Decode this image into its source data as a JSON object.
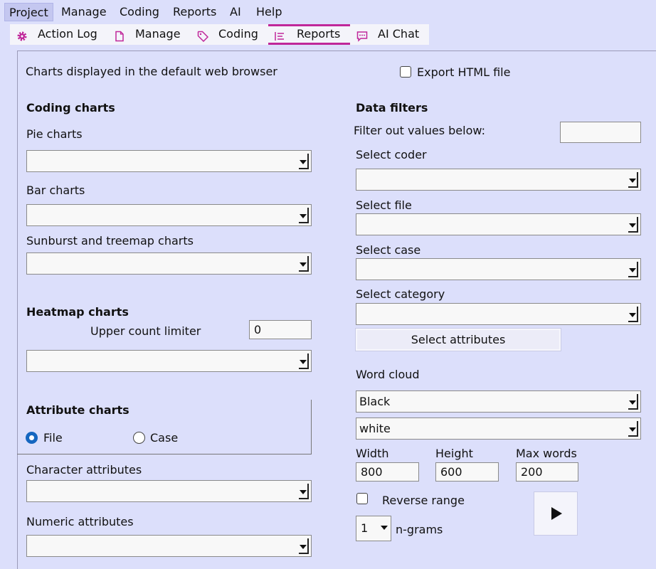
{
  "menu": {
    "items": [
      {
        "label": "Project"
      },
      {
        "label": "Manage"
      },
      {
        "label": "Coding"
      },
      {
        "label": "Reports"
      },
      {
        "label": "AI"
      },
      {
        "label": "Help"
      }
    ],
    "active": "Project"
  },
  "tabs": {
    "items": [
      {
        "label": "Action Log",
        "icon": "gear-icon"
      },
      {
        "label": "Manage",
        "icon": "document-icon"
      },
      {
        "label": "Coding",
        "icon": "tag-icon"
      },
      {
        "label": "Reports",
        "icon": "list-icon"
      },
      {
        "label": "AI Chat",
        "icon": "chat-icon"
      }
    ],
    "active": "Reports",
    "accent_color": "#c0279a"
  },
  "header": {
    "description": "Charts displayed in the default web browser",
    "export_label": "Export HTML file",
    "export_checked": false
  },
  "coding_charts": {
    "title": "Coding charts",
    "pie_label": "Pie charts",
    "pie_value": "",
    "bar_label": "Bar charts",
    "bar_value": "",
    "sunburst_label": "Sunburst and treemap charts",
    "sunburst_value": ""
  },
  "heatmap": {
    "title": "Heatmap charts",
    "limiter_label": "Upper count limiter",
    "limiter_value": "0",
    "select_value": ""
  },
  "attribute_charts": {
    "title": "Attribute charts",
    "radio_file": "File",
    "radio_case": "Case",
    "selected": "File",
    "character_label": "Character attributes",
    "character_value": "",
    "numeric_label": "Numeric attributes",
    "numeric_value": ""
  },
  "data_filters": {
    "title": "Data filters",
    "filter_label": "Filter out values below:",
    "filter_value": "",
    "coder_label": "Select coder",
    "coder_value": "",
    "file_label": "Select file",
    "file_value": "",
    "case_label": "Select case",
    "case_value": "",
    "category_label": "Select category",
    "category_value": "",
    "attributes_button": "Select attributes"
  },
  "word_cloud": {
    "title": "Word cloud",
    "foreground": "Black",
    "background": "white",
    "width_label": "Width",
    "width_value": "800",
    "height_label": "Height",
    "height_value": "600",
    "max_words_label": "Max words",
    "max_words_value": "200",
    "reverse_label": "Reverse range",
    "reverse_checked": false,
    "ngrams_value": "1",
    "ngrams_label": "n-grams",
    "run_icon": "play-icon"
  },
  "colors": {
    "background": "#dcdffb",
    "radio_selected": "#1566c0"
  }
}
